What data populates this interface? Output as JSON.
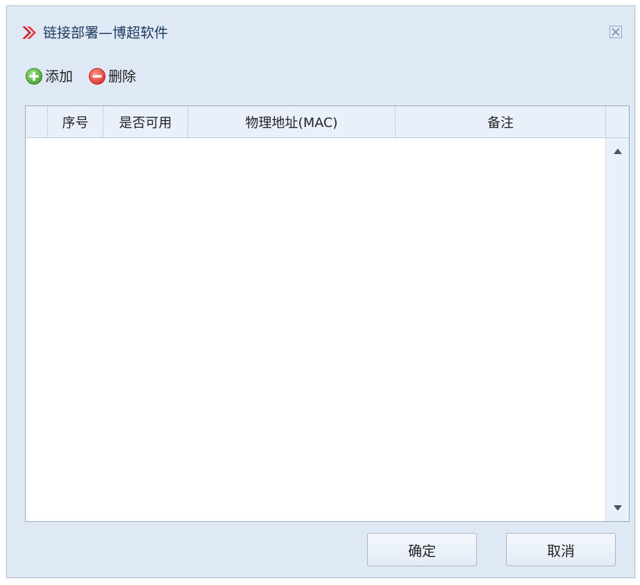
{
  "window": {
    "title": "链接部署—博超软件",
    "logo_icon": "red-chevron-logo-icon",
    "close_icon": "close-x-icon",
    "accent_color": "#c8262c"
  },
  "toolbar": {
    "add_label": "添加",
    "add_icon": "green-plus-circle-icon",
    "delete_label": "删除",
    "delete_icon": "red-minus-circle-icon"
  },
  "grid": {
    "columns": [
      {
        "label": ""
      },
      {
        "label": "序号"
      },
      {
        "label": "是否可用"
      },
      {
        "label": "物理地址(MAC)"
      },
      {
        "label": "备注"
      },
      {
        "label": ""
      }
    ],
    "rows": []
  },
  "footer": {
    "ok_label": "确定",
    "cancel_label": "取消"
  }
}
